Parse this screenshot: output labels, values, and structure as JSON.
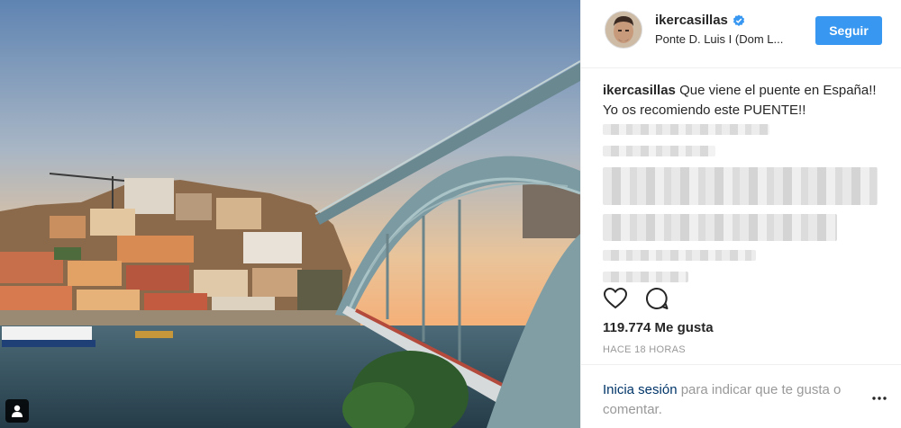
{
  "post": {
    "photo_alt": "",
    "user_tag_icon": "user-tag-icon"
  },
  "header": {
    "username": "ikercasillas",
    "verified_icon": "verified-badge-icon",
    "location": "Ponte D. Luis I (Dom L...",
    "follow_label": "Seguir"
  },
  "caption": {
    "username": "ikercasillas",
    "text": "Que viene el puente en España!! Yo os recomiendo este PUENTE!!"
  },
  "actions": {
    "like_icon": "heart-icon",
    "comment_icon": "comment-icon"
  },
  "likes_text": "119.774 Me gusta",
  "timestamp": "HACE 18 HORAS",
  "footer": {
    "login_link": "Inicia sesión",
    "login_rest": " para indicar que te gusta o comentar.",
    "more_icon": "more-options-icon"
  },
  "colors": {
    "follow_button": "#3897f0",
    "verified": "#3897f0",
    "login_link": "#003569"
  }
}
